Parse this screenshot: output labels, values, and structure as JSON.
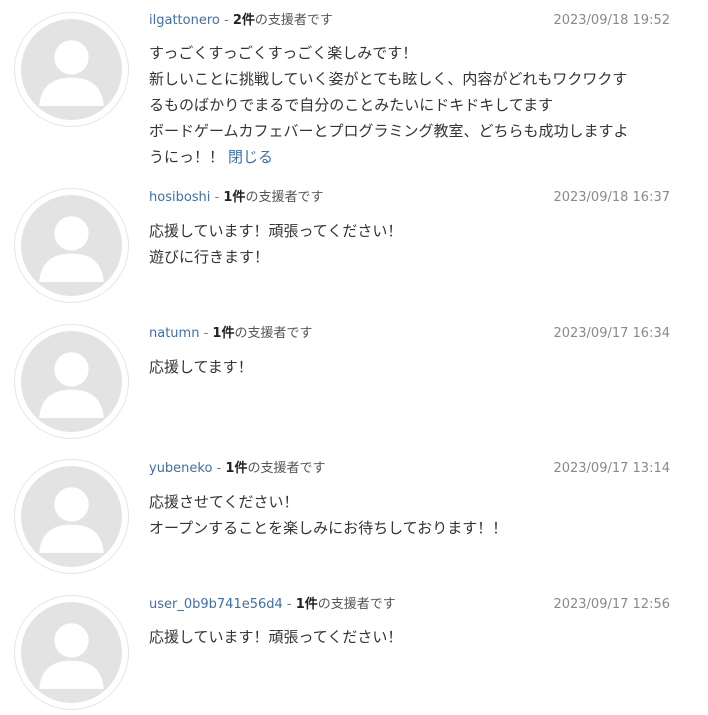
{
  "comments": [
    {
      "username": "ilgattonero",
      "count": "2件",
      "supporter_suffix": "の支援者です",
      "date": "2023/09/18 19:52",
      "lines": [
        "すっごくすっごくすっごく楽しみです！",
        "新しいことに挑戦していく姿がとても眩しく、内容がどれもワクワクす",
        "るものばかりでまるで自分のことみたいにドキドキしてます",
        "ボードゲームカフェバーとプログラミング教室、どちらも成功しますよ",
        "うにっ！！"
      ],
      "toggle_label": "閉じる"
    },
    {
      "username": "hosiboshi",
      "count": "1件",
      "supporter_suffix": "の支援者です",
      "date": "2023/09/18 16:37",
      "lines": [
        "応援しています！頑張ってください！",
        "遊びに行きます！"
      ]
    },
    {
      "username": "natumn",
      "count": "1件",
      "supporter_suffix": "の支援者です",
      "date": "2023/09/17 16:34",
      "lines": [
        "応援してます！"
      ]
    },
    {
      "username": "yubeneko",
      "count": "1件",
      "supporter_suffix": "の支援者です",
      "date": "2023/09/17 13:14",
      "lines": [
        "応援させてください！",
        "オープンすることを楽しみにお待ちしております！！"
      ]
    },
    {
      "username": "user_0b9b741e56d4",
      "count": "1件",
      "supporter_suffix": "の支援者です",
      "date": "2023/09/17 12:56",
      "lines": [
        "応援しています！頑張ってください！"
      ]
    }
  ]
}
